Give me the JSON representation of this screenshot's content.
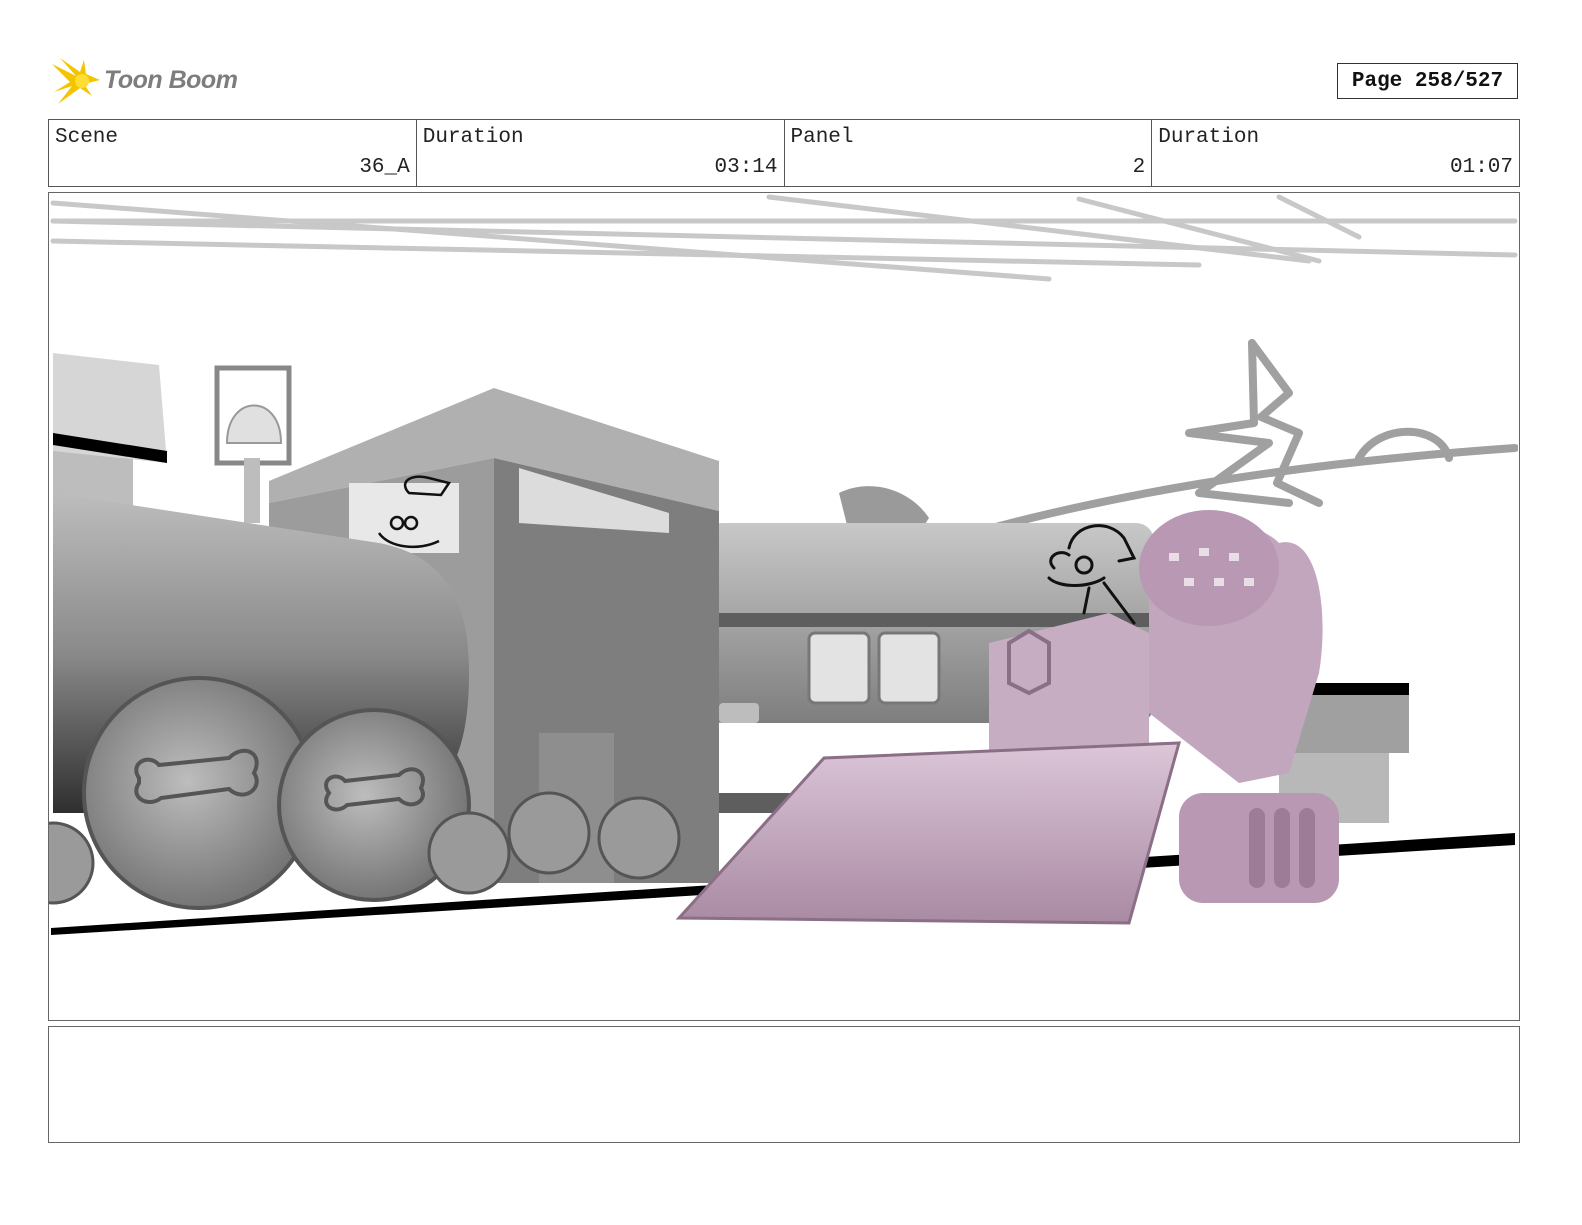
{
  "header": {
    "logo_text": "Toon Boom",
    "page_label": "Page 258/527"
  },
  "info": {
    "scene_label": "Scene",
    "scene_value": "36_A",
    "scene_duration_label": "Duration",
    "scene_duration_value": "03:14",
    "panel_label": "Panel",
    "panel_value": "2",
    "panel_duration_label": "Duration",
    "panel_duration_value": "01:07"
  },
  "colors": {
    "logo_yellow": "#f5c400",
    "logo_text": "#7d7d7d",
    "train_gray": "#9a9a9a",
    "bulldozer_pink": "#c9aec4",
    "sketch_gray": "#a0a0a0"
  },
  "notes": {
    "text": ""
  }
}
